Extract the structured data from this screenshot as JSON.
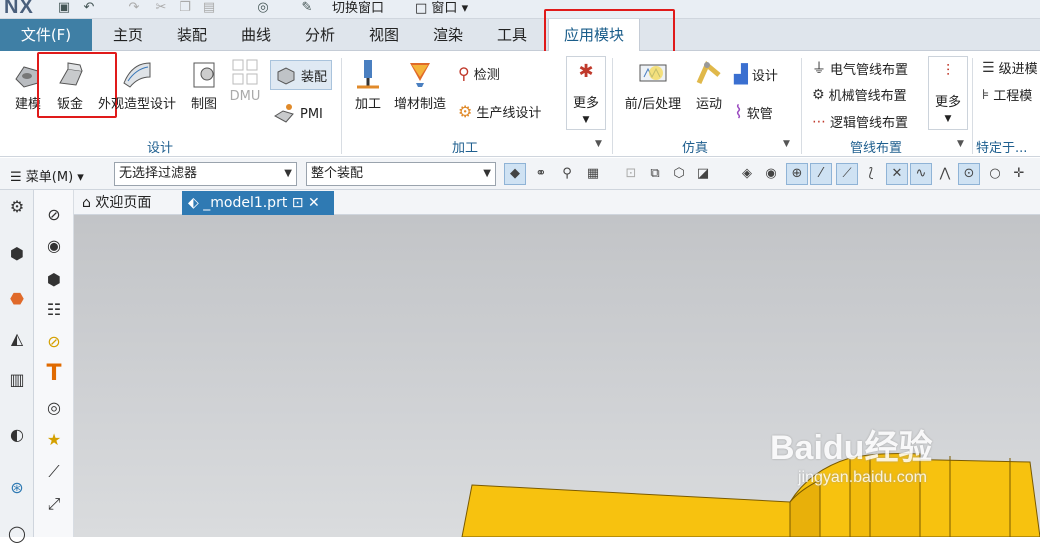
{
  "app": {
    "logo": "NX"
  },
  "quick_access": {
    "switch_window": "切换窗口",
    "window": "窗口"
  },
  "tabs": {
    "file": "文件(F)",
    "items": [
      "主页",
      "装配",
      "曲线",
      "分析",
      "视图",
      "渲染",
      "工具",
      "应用模块"
    ],
    "active": "应用模块"
  },
  "ribbon": {
    "design": {
      "group": "设计",
      "modeling": "建模",
      "sheet_metal": "钣金",
      "styling": "外观造型设计",
      "drafting": "制图",
      "dmu": "DMU",
      "assembly": "装配",
      "pmi": "PMI"
    },
    "manufacturing": {
      "group": "加工",
      "machining": "加工",
      "additive": "增材制造",
      "inspection": "检测",
      "line_designer": "生产线设计",
      "more": "更多"
    },
    "simulation": {
      "group": "仿真",
      "pre_post": "前/后处理",
      "motion": "运动",
      "design": "设计",
      "hose": "软管"
    },
    "routing": {
      "group": "管线布置",
      "electrical": "电气管线布置",
      "mechanical": "机械管线布置",
      "logical": "逻辑管线布置",
      "more": "更多"
    },
    "specific": {
      "group": "特定于...",
      "progressive_die": "级进模",
      "engineering": "工程模"
    }
  },
  "toolbar": {
    "menu": "菜单(M)",
    "filter": "无选择过滤器",
    "scope": "整个装配"
  },
  "doc_tabs": {
    "welcome": "欢迎页面",
    "model": "_model1.prt"
  },
  "watermark": {
    "brand": "Baidu经验",
    "url": "jingyan.baidu.com"
  },
  "colors": {
    "accent": "#3f7fa5",
    "highlight_box": "#e01a1a",
    "model_yellow": "#f7c20f",
    "active_doc_tab": "#2f7ab3"
  }
}
